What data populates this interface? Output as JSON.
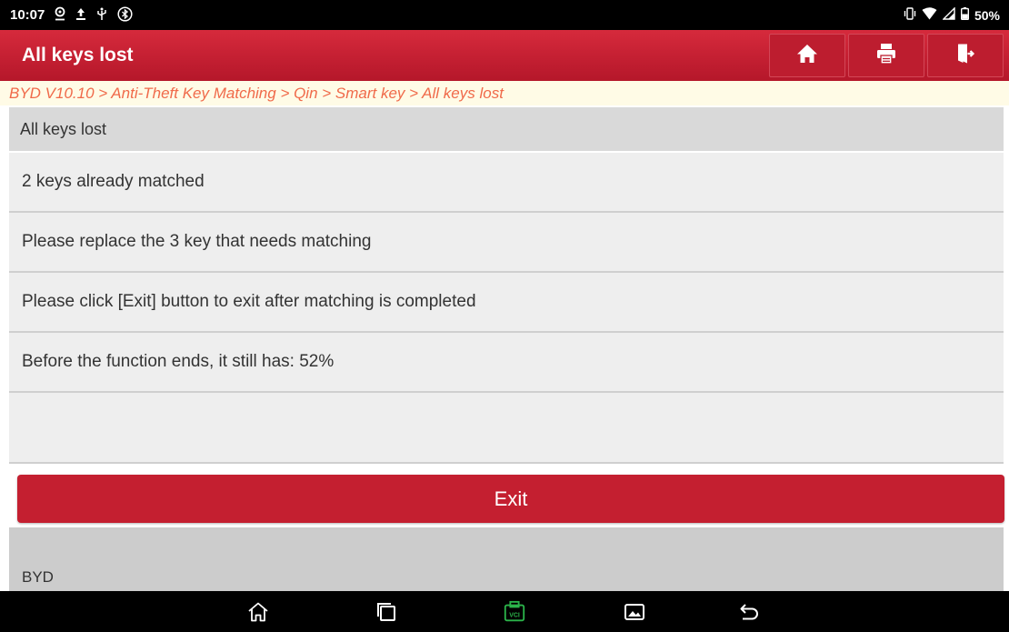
{
  "status_bar": {
    "time": "10:07",
    "battery": "50%",
    "left_icons": [
      "location-icon",
      "upload-icon",
      "usb-icon",
      "bluetooth-icon"
    ],
    "right_icons": [
      "vibrate-icon",
      "wifi-icon",
      "signal-icon",
      "battery-icon"
    ]
  },
  "title_bar": {
    "title": "All keys lost",
    "buttons": [
      "home-icon",
      "print-icon",
      "exit-door-icon"
    ],
    "background_color": "#c41f30"
  },
  "breadcrumb": "BYD V10.10 > Anti-Theft Key Matching > Qin > Smart key > All keys lost",
  "section_header": "All keys lost",
  "messages": [
    "2 keys already matched",
    "Please replace the 3 key that needs matching",
    "Please click [Exit] button to exit after matching is completed",
    "Before the function ends, it still has: 52%"
  ],
  "exit_button": "Exit",
  "footer": {
    "brand": "BYD"
  },
  "nav_bar": {
    "icons": [
      "home-outline-icon",
      "recent-apps-icon",
      "vci-icon",
      "gallery-icon",
      "back-icon"
    ],
    "vci_label": "VCI",
    "vci_color": "#2bb34a"
  }
}
